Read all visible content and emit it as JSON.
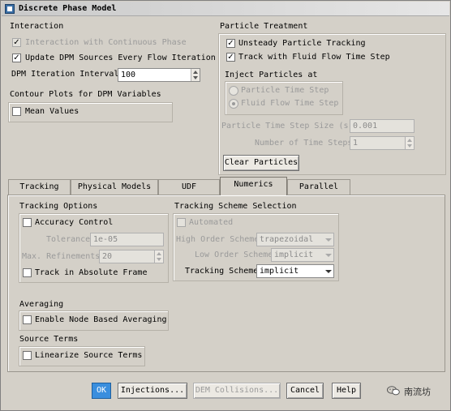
{
  "window": {
    "title": "Discrete Phase Model"
  },
  "interaction": {
    "title": "Interaction",
    "continuous_phase": {
      "label": "Interaction with Continuous Phase",
      "checked": true,
      "enabled": false
    },
    "update_dpm": {
      "label": "Update DPM Sources Every Flow Iteration",
      "checked": true
    },
    "iteration_interval": {
      "label": "DPM Iteration Interval",
      "value": "100"
    }
  },
  "contour": {
    "title": "Contour Plots for DPM Variables",
    "mean_values": {
      "label": "Mean Values",
      "checked": false
    }
  },
  "particle_treatment": {
    "title": "Particle Treatment",
    "unsteady": {
      "label": "Unsteady Particle Tracking",
      "checked": true
    },
    "track_flow": {
      "label": "Track with Fluid Flow Time Step",
      "checked": true
    },
    "inject_title": "Inject Particles at",
    "radio_particle": {
      "label": "Particle Time Step",
      "selected": false
    },
    "radio_flow": {
      "label": "Fluid Flow Time Step",
      "selected": true
    },
    "step_size": {
      "label": "Particle Time Step Size (s)",
      "value": "0.001"
    },
    "num_steps": {
      "label": "Number of Time Steps",
      "value": "1"
    },
    "clear_button": "Clear Particles"
  },
  "tabs": [
    {
      "label": "Tracking",
      "active": false
    },
    {
      "label": "Physical Models",
      "active": false
    },
    {
      "label": "UDF",
      "active": false
    },
    {
      "label": "Numerics",
      "active": true
    },
    {
      "label": "Parallel",
      "active": false
    }
  ],
  "numerics": {
    "tracking_options": {
      "title": "Tracking Options",
      "accuracy": {
        "label": "Accuracy Control",
        "checked": false
      },
      "tolerance": {
        "label": "Tolerance",
        "value": "1e-05"
      },
      "max_ref": {
        "label": "Max. Refinements",
        "value": "20"
      },
      "absolute": {
        "label": "Track in Absolute Frame",
        "checked": false
      }
    },
    "scheme": {
      "title": "Tracking Scheme Selection",
      "automated": {
        "label": "Automated",
        "checked": false
      },
      "high_order": {
        "label": "High Order Scheme",
        "value": "trapezoidal"
      },
      "low_order": {
        "label": "Low Order Scheme",
        "value": "implicit"
      },
      "tracking": {
        "label": "Tracking Scheme",
        "value": "implicit"
      }
    },
    "averaging": {
      "title": "Averaging",
      "node_based": {
        "label": "Enable Node Based Averaging",
        "checked": false
      }
    },
    "source_terms": {
      "title": "Source Terms",
      "linearize": {
        "label": "Linearize Source Terms",
        "checked": false
      }
    }
  },
  "buttons": {
    "ok": "OK",
    "injections": "Injections...",
    "dem": "DEM Collisions...",
    "cancel": "Cancel",
    "help": "Help"
  },
  "watermark": {
    "text": "南流坊",
    "icon": "wechat-icon"
  },
  "colors": {
    "ok_button": "#3a8ede",
    "window_bg": "#d4d0c8"
  }
}
